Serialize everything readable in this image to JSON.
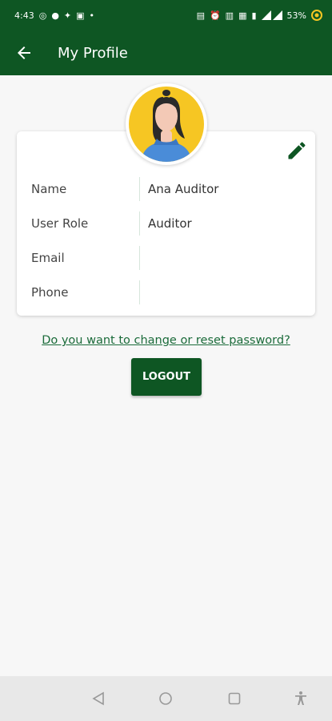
{
  "status_bar": {
    "time": "4:43",
    "battery": "53%",
    "left_icons": [
      "whatsapp-icon",
      "facebook-icon",
      "twitter-icon",
      "gallery-icon",
      "dot-icon"
    ],
    "right_icons": [
      "network-speed-icon",
      "alarm-icon",
      "nfc-icon",
      "volte-icon",
      "vibrate-icon",
      "signal-icon",
      "battery-icon"
    ]
  },
  "appbar": {
    "title": "My Profile"
  },
  "profile": {
    "fields": [
      {
        "label": "Name",
        "value": "Ana Auditor"
      },
      {
        "label": "User Role",
        "value": "Auditor"
      },
      {
        "label": "Email",
        "value": ""
      },
      {
        "label": "Phone",
        "value": ""
      }
    ]
  },
  "actions": {
    "reset_password_link": "Do you want to change or reset password?",
    "logout_label": "LOGOUT"
  },
  "colors": {
    "primary": "#0e5623",
    "link": "#1b6b3a",
    "avatar_bg": "#f6c623"
  }
}
